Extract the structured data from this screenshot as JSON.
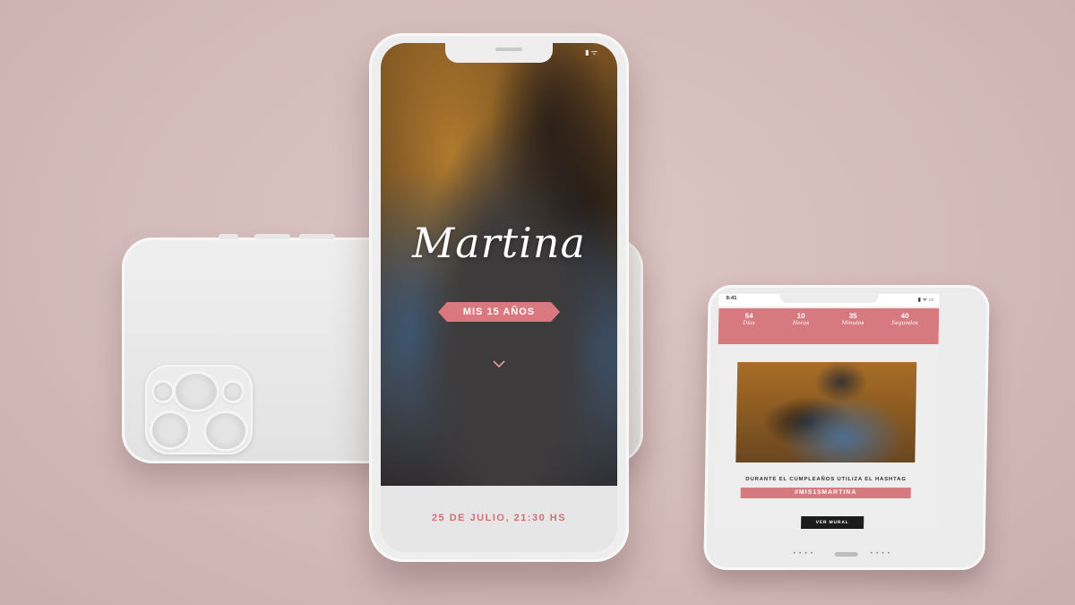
{
  "main_phone": {
    "status_time": "",
    "status_icons": "▮ ᯤ",
    "name": "Martina",
    "ribbon": "MIS 15 AÑOS",
    "scroll_icon": "chevron-down-icon",
    "date": "25 DE JULIO, 21:30 HS"
  },
  "right_phone": {
    "status_time": "9:41",
    "status_icons": "▮ ᯤ ▭",
    "countdown": [
      {
        "value": "54",
        "label": "Días"
      },
      {
        "value": "10",
        "label": "Horas"
      },
      {
        "value": "35",
        "label": "Minutos"
      },
      {
        "value": "40",
        "label": "Segundos"
      }
    ],
    "hashtag_note": "DURANTE EL CUMPLEAÑOS UTILIZA EL HASHTAG",
    "hashtag": "#MIS15MARTINA",
    "button": "VER MURAL",
    "speaker_left": "• • • •",
    "speaker_right": "• • • •"
  },
  "colors": {
    "background": "#d6bfbd",
    "accent": "#d77a80",
    "phone_body": "#eeeeee"
  }
}
